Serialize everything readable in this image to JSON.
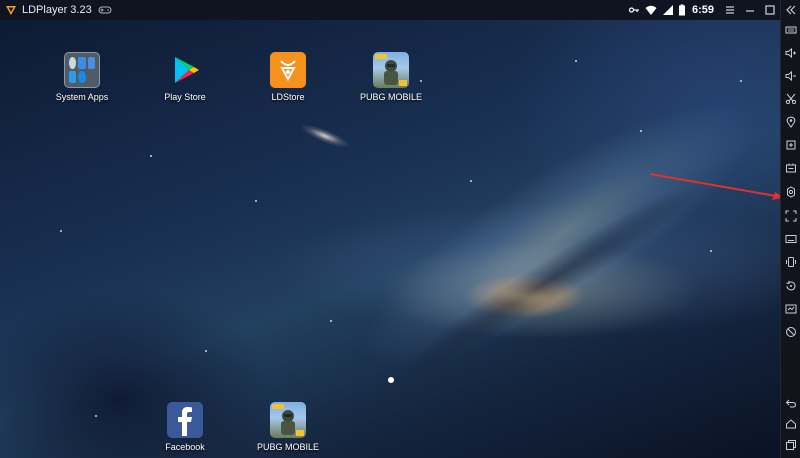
{
  "window": {
    "title": "LDPlayer 3.23"
  },
  "status": {
    "time": "6:59"
  },
  "colors": {
    "accent": "#f5a623",
    "arrow": "#e0312c",
    "titlebar_bg": "#0f1420",
    "sidebar_bg": "#11141b"
  },
  "desktop_apps": [
    {
      "label": "System Apps",
      "icon": "folder-grid-icon"
    },
    {
      "label": "Play Store",
      "icon": "play-store-icon"
    },
    {
      "label": "LDStore",
      "icon": "ldstore-icon"
    },
    {
      "label": "PUBG MOBILE",
      "icon": "pubg-icon"
    }
  ],
  "dock_apps": [
    {
      "label": "Facebook",
      "icon": "facebook-icon"
    },
    {
      "label": "PUBG MOBILE",
      "icon": "pubg-icon"
    }
  ],
  "sidebar_items": [
    "keyboard-mapping",
    "volume-up",
    "volume-down",
    "screenshot",
    "location",
    "install-apk",
    "shared-folder",
    "settings",
    "fullscreen",
    "keyboard",
    "shake",
    "rotate",
    "operation-record",
    "sync",
    "back",
    "home",
    "recent-apps"
  ]
}
